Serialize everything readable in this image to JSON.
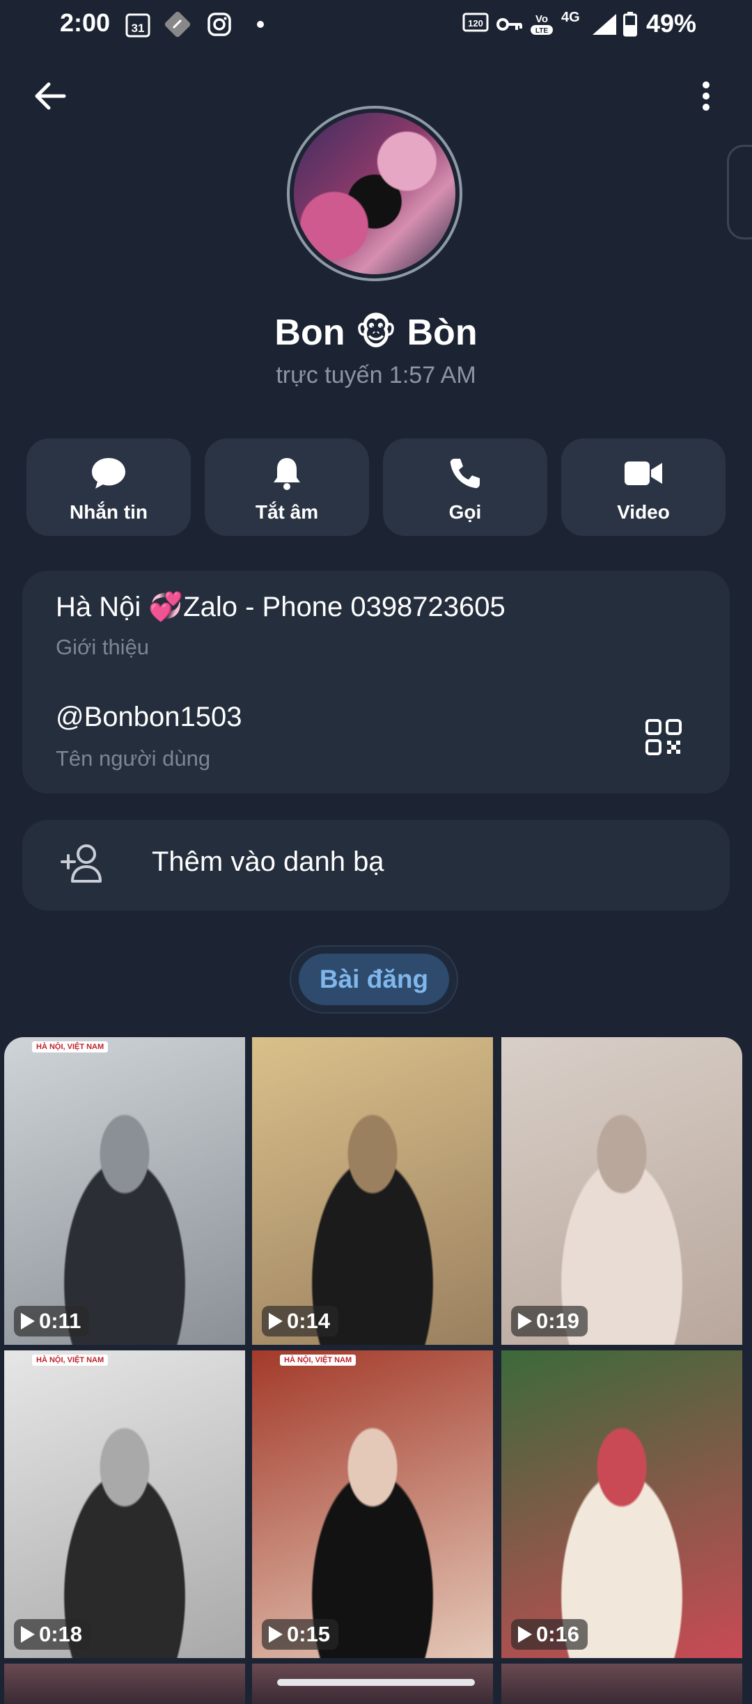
{
  "status_bar": {
    "time": "2:00",
    "calendar_day": "31",
    "refresh_rate": "120 Hz",
    "network": "4G",
    "battery": "49%",
    "icons": [
      "calendar-icon",
      "maps-icon",
      "instagram-icon",
      "dot-icon",
      "refresh-rate-icon",
      "vpn-key-icon",
      "volte-icon",
      "signal-icon",
      "battery-icon"
    ]
  },
  "header": {
    "back_icon": "back-arrow-icon",
    "more_icon": "more-vertical-icon"
  },
  "profile": {
    "name": "Bon 🐵 Bòn",
    "status": "trực tuyến 1:57 AM"
  },
  "actions": [
    {
      "label": "Nhắn tin",
      "icon": "message-icon"
    },
    {
      "label": "Tắt âm",
      "icon": "bell-icon"
    },
    {
      "label": "Gọi",
      "icon": "phone-icon"
    },
    {
      "label": "Video",
      "icon": "video-icon"
    }
  ],
  "info": {
    "bio": "Hà Nội 💞Zalo - Phone 0398723605",
    "bio_label": "Giới thiệu",
    "username": "@Bonbon1503",
    "username_label": "Tên người dùng"
  },
  "add_contact": {
    "label": "Thêm vào danh bạ",
    "icon": "add-person-icon"
  },
  "tab": {
    "label": "Bài đăng"
  },
  "posts": [
    {
      "duration": "0:11",
      "tag": "HÀ NỘI, VIỆT NAM",
      "colors": [
        "#cfd4d8",
        "#8a9096",
        "#2b2f35"
      ]
    },
    {
      "duration": "0:14",
      "tag": "",
      "colors": [
        "#d9c08a",
        "#9b8060",
        "#1b1b1b"
      ]
    },
    {
      "duration": "0:19",
      "tag": "",
      "colors": [
        "#d8cfc8",
        "#b9a79c",
        "#e8dcd4"
      ]
    },
    {
      "duration": "0:18",
      "tag": "HÀ NỘI, VIỆT NAM",
      "colors": [
        "#e6e6e6",
        "#a9a9a9",
        "#2a2a2a"
      ]
    },
    {
      "duration": "0:15",
      "tag": "HÀ NỘI, VIỆT NAM",
      "colors": [
        "#a33a2a",
        "#e4c8b8",
        "#121212"
      ]
    },
    {
      "duration": "0:16",
      "tag": "",
      "colors": [
        "#3b6a3a",
        "#c94a55",
        "#f1e7da"
      ]
    }
  ]
}
